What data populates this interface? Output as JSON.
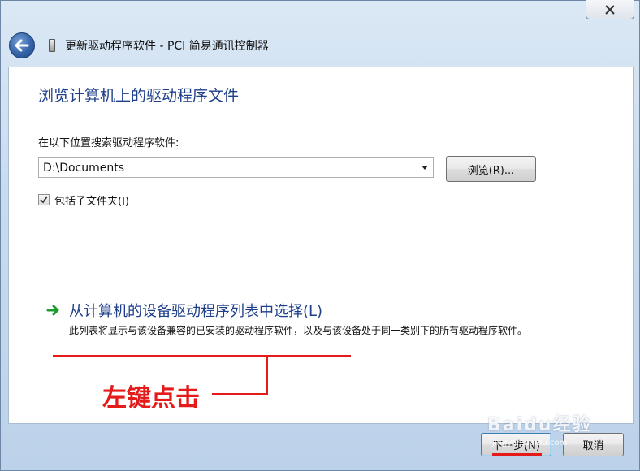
{
  "window": {
    "title": "更新驱动程序软件 - PCI 简易通讯控制器",
    "close_icon": "close-icon",
    "back_icon": "back-arrow-icon",
    "device_icon": "device-icon"
  },
  "page": {
    "heading": "浏览计算机上的驱动程序文件",
    "search_label": "在以下位置搜索驱动程序软件:",
    "path_value": "D:\\Documents",
    "browse_label": "浏览(R)...",
    "include_subfolders_label": "包括子文件夹(I)",
    "include_subfolders_checked": true
  },
  "option": {
    "icon": "green-arrow-icon",
    "title": "从计算机的设备驱动程序列表中选择(L)",
    "description": "此列表将显示与该设备兼容的已安装的驱动程序软件，以及与该设备处于同一类别下的所有驱动程序软件。"
  },
  "annotation": {
    "text": "左键点击",
    "color": "#e51a1a"
  },
  "footer": {
    "next_label": "下一步(N)",
    "cancel_label": "取消"
  },
  "watermark": {
    "text": "Baidu经验",
    "sub": "jingyan.baidu.com"
  },
  "colors": {
    "heading": "#1e3f8a",
    "annotation": "#e51a1a"
  }
}
